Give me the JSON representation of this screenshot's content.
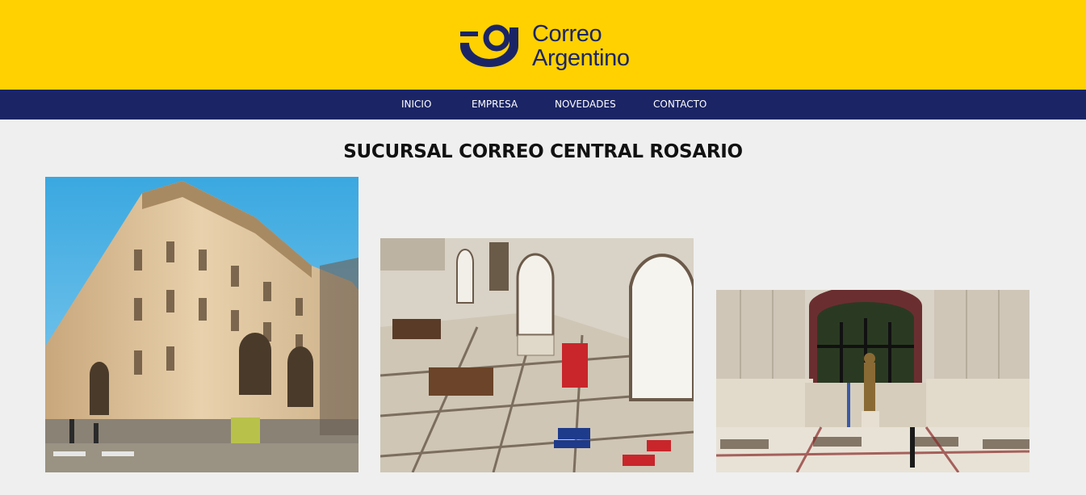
{
  "brand": {
    "name_line1": "Correo",
    "name_line2": "Argentino",
    "colors": {
      "yellow": "#ffd100",
      "navy": "#1b2566"
    }
  },
  "nav": {
    "items": [
      {
        "label": "INICIO"
      },
      {
        "label": "EMPRESA"
      },
      {
        "label": "NOVEDADES"
      },
      {
        "label": "CONTACTO"
      }
    ]
  },
  "main": {
    "title": "SUCURSAL CORREO CENTRAL ROSARIO",
    "photos": [
      {
        "subject": "building-exterior"
      },
      {
        "subject": "interior-hall"
      },
      {
        "subject": "interior-statue"
      }
    ]
  }
}
